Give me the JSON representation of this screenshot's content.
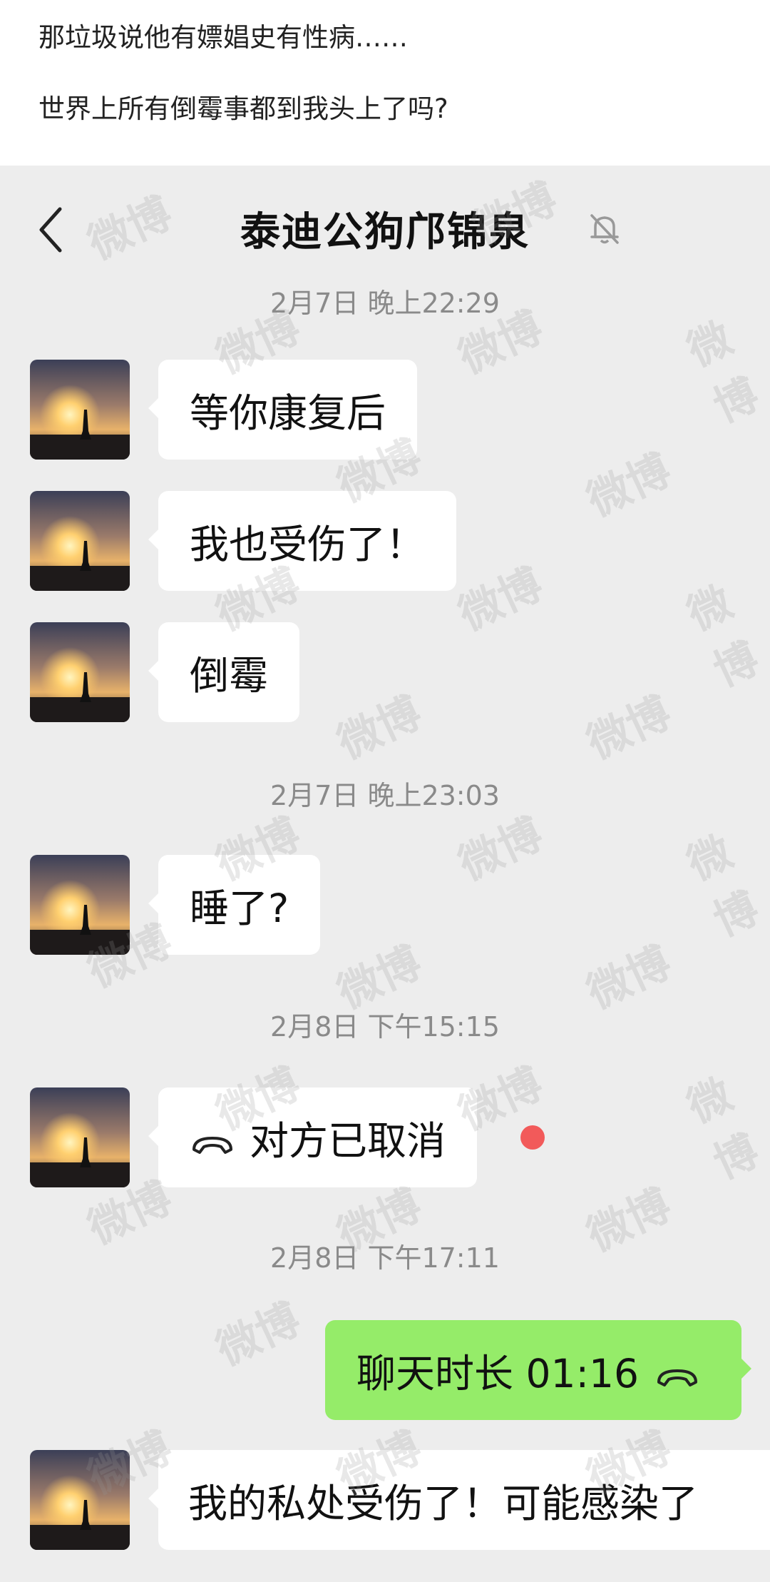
{
  "post": {
    "line1": "那垃圾说他有嫖娼史有性病……",
    "line2": "世界上所有倒霉事都到我头上了吗?"
  },
  "header": {
    "title": "泰迪公狗邝锦泉",
    "back_icon": "chevron-left-icon",
    "mute_icon": "bell-muted-icon"
  },
  "messages": [
    {
      "type": "time",
      "text": "2月7日 晚上22:29"
    },
    {
      "type": "received",
      "text": "等你康复后"
    },
    {
      "type": "received",
      "text": "我也受伤了！"
    },
    {
      "type": "received",
      "text": "倒霉"
    },
    {
      "type": "time",
      "text": "2月7日 晚上23:03"
    },
    {
      "type": "received",
      "text": "睡了?"
    },
    {
      "type": "time",
      "text": "2月8日 下午15:15"
    },
    {
      "type": "received_call",
      "text": "对方已取消",
      "icon": "phone-hangup-icon",
      "unread": true
    },
    {
      "type": "time",
      "text": "2月8日 下午17:11"
    },
    {
      "type": "sent_call",
      "text": "聊天时长 01:16",
      "icon": "phone-hangup-icon"
    },
    {
      "type": "received",
      "text": "我的私处受伤了！可能感染了"
    }
  ],
  "watermark": "微博",
  "colors": {
    "sent_bubble": "#95ec69",
    "received_bubble": "#ffffff",
    "chat_background": "#ededed",
    "unread_dot": "#f25a5a"
  }
}
